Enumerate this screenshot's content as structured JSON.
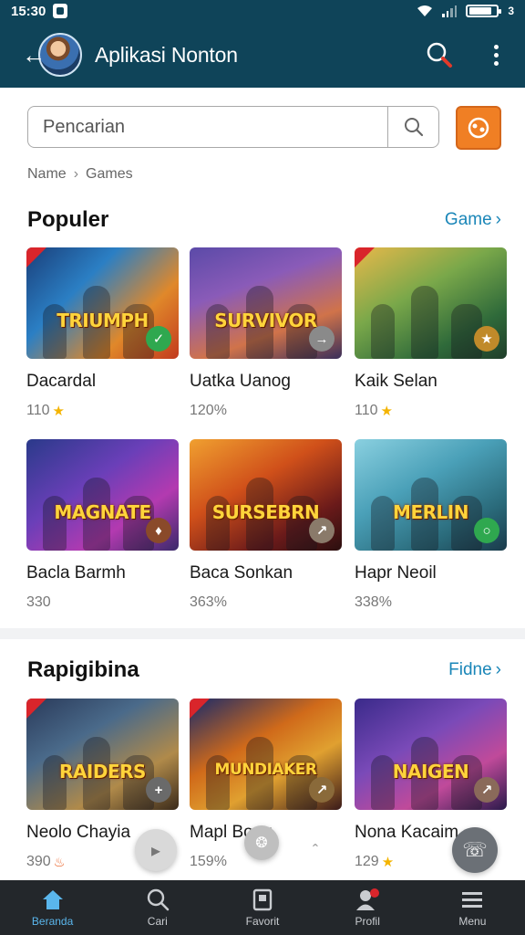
{
  "status_bar": {
    "time": "15:30",
    "battery_label": "3",
    "battery_level": 0.85
  },
  "app_bar": {
    "title": "Aplikasi Nonton",
    "back_icon": "arrow-left-icon",
    "search_icon": "search-icon",
    "menu_icon": "more-vert-icon"
  },
  "search": {
    "placeholder": "Pencarian",
    "value": ""
  },
  "breadcrumb": {
    "items": [
      "Name",
      "Games"
    ]
  },
  "section1": {
    "title": "Populer",
    "see_more": "Game",
    "cards": [
      {
        "art": "TRIUMPH",
        "title": "Dacardal",
        "meta": "110",
        "meta_icon": "star",
        "badge_color": "#2fa84f",
        "badge_glyph": "✓",
        "ribbon": true,
        "bg": "linear-gradient(135deg,#1a3f7a 0%,#2b7fc4 35%,#e0882a 70%,#c23a1e 100%)"
      },
      {
        "art": "SURVIVOR",
        "title": "Uatka Uanog",
        "meta": "120%",
        "meta_icon": "",
        "badge_color": "#8a8a8a",
        "badge_glyph": "→",
        "ribbon": false,
        "bg": "linear-gradient(160deg,#5b4aa8 0%,#8a5bb8 35%,#d0734a 70%,#3a2f5a 100%)"
      },
      {
        "art": "",
        "title": "Kaik Selan",
        "meta": "110",
        "meta_icon": "star",
        "badge_color": "#c08a2a",
        "badge_glyph": "★",
        "ribbon": true,
        "bg": "linear-gradient(150deg,#e8b84a 0%,#7aa84a 40%,#2f6a3a 75%,#1f3d2a 100%)"
      },
      {
        "art": "MAGNATE",
        "title": "Bacla Barmh",
        "meta": "330",
        "meta_icon": "",
        "badge_color": "#8a4a2a",
        "badge_glyph": "♦",
        "ribbon": false,
        "bg": "linear-gradient(145deg,#2a3a8a 0%,#6a3fb8 40%,#b33ab0 70%,#3a2a6a 100%)"
      },
      {
        "art": "SURSEBRN",
        "title": "Baca Sonkan",
        "meta": "363%",
        "meta_icon": "",
        "badge_color": "#8a7a6a",
        "badge_glyph": "↗",
        "ribbon": false,
        "bg": "linear-gradient(150deg,#f0a030 0%,#d0501a 40%,#6a1a1a 75%,#2a0f0f 100%)"
      },
      {
        "art": "MERLIN",
        "title": "Hapr Neoil",
        "meta": "338%",
        "meta_icon": "",
        "badge_color": "#2fa84f",
        "badge_glyph": "○",
        "ribbon": false,
        "bg": "linear-gradient(150deg,#8ad0e0 0%,#4aa0b8 40%,#2a6a7a 75%,#1a3a4a 100%)"
      }
    ]
  },
  "section2": {
    "title": "Rapigibina",
    "see_more": "Fidne",
    "cards": [
      {
        "art": "RAIDERS",
        "title": "Neolo Chayia",
        "meta": "390",
        "meta_icon": "flame",
        "badge_color": "#6a6a6a",
        "badge_glyph": "+",
        "ribbon": true,
        "bg": "linear-gradient(150deg,#2a3a5a 0%,#4a6a8a 35%,#b08a4a 70%,#3a2a1a 100%)"
      },
      {
        "art": "MUNDIAKER",
        "title": "Mapl Bong",
        "meta": "159%",
        "meta_icon": "",
        "badge_color": "#8a6a3a",
        "badge_glyph": "↗",
        "ribbon": true,
        "bg": "linear-gradient(150deg,#1a2a6a 0%,#d06a1a 40%,#e0a030 65%,#3a1a1a 100%)"
      },
      {
        "art": "NAIGEN",
        "title": "Nona Kacaim",
        "meta": "129",
        "meta_icon": "star",
        "badge_color": "#8a6a5a",
        "badge_glyph": "↗",
        "ribbon": false,
        "bg": "linear-gradient(150deg,#3a2a8a 0%,#7a4ab8 40%,#c04a9a 70%,#2a1a4a 100%)"
      }
    ]
  },
  "bottom_nav": {
    "items": [
      {
        "label": "Beranda",
        "icon": "home-icon",
        "active": true
      },
      {
        "label": "Cari",
        "icon": "search-icon",
        "active": false
      },
      {
        "label": "Favorit",
        "icon": "bookmark-icon",
        "active": false
      },
      {
        "label": "Profil",
        "icon": "profile-icon",
        "active": false
      },
      {
        "label": "Menu",
        "icon": "menu-icon",
        "active": false
      }
    ]
  },
  "colors": {
    "primary": "#0f4459",
    "accent": "#f07f24",
    "link": "#1a86b8",
    "nav_bg": "#23272b",
    "nav_active": "#5ab6ec"
  }
}
